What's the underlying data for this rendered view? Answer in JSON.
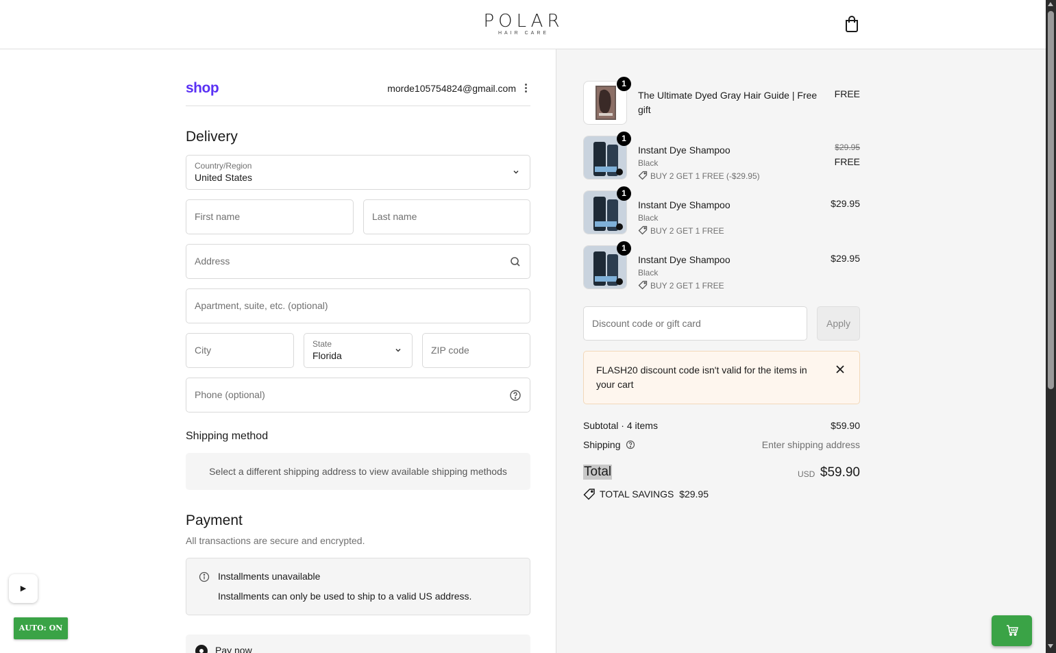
{
  "header": {
    "logo_main": "POLAR",
    "logo_sub": "HAIR CARE"
  },
  "account": {
    "shop_label": "shop",
    "email": "morde105754824@gmail.com"
  },
  "delivery": {
    "heading": "Delivery",
    "country": {
      "label": "Country/Region",
      "value": "United States"
    },
    "first_name": {
      "placeholder": "First name"
    },
    "last_name": {
      "placeholder": "Last name"
    },
    "address": {
      "placeholder": "Address"
    },
    "apartment": {
      "placeholder": "Apartment, suite, etc. (optional)"
    },
    "city": {
      "placeholder": "City"
    },
    "state": {
      "label": "State",
      "value": "Florida"
    },
    "zip": {
      "placeholder": "ZIP code"
    },
    "phone": {
      "placeholder": "Phone (optional)"
    }
  },
  "shipping": {
    "heading": "Shipping method",
    "message": "Select a different shipping address to view available shipping methods"
  },
  "payment": {
    "heading": "Payment",
    "subtitle": "All transactions are secure and encrypted.",
    "installments_title": "Installments unavailable",
    "installments_text": "Installments can only be used to ship to a valid US address.",
    "pay_now_label": "Pay now"
  },
  "controls": {
    "play_symbol": "▶",
    "auto_label": "AUTO: ON"
  },
  "order": {
    "items": [
      {
        "qty": "1",
        "name": "The Ultimate Dyed Gray Hair Guide | Free gift",
        "price": "FREE"
      },
      {
        "qty": "1",
        "name": "Instant Dye Shampoo",
        "variant": "Black",
        "discount": "BUY 2 GET 1 FREE (-$29.95)",
        "old_price": "$29.95",
        "price": "FREE"
      },
      {
        "qty": "1",
        "name": "Instant Dye Shampoo",
        "variant": "Black",
        "discount": "BUY 2 GET 1 FREE",
        "price": "$29.95"
      },
      {
        "qty": "1",
        "name": "Instant Dye Shampoo",
        "variant": "Black",
        "discount": "BUY 2 GET 1 FREE",
        "price": "$29.95"
      }
    ],
    "discount_placeholder": "Discount code or gift card",
    "apply_label": "Apply",
    "alert_text": "FLASH20 discount code isn't valid for the items in your cart",
    "subtotal_label": "Subtotal · 4 items",
    "subtotal_value": "$59.90",
    "shipping_label": "Shipping",
    "shipping_value": "Enter shipping address",
    "total_label": "Total",
    "total_currency": "USD",
    "total_value": "$59.90",
    "savings_label": "TOTAL SAVINGS",
    "savings_value": "$29.95"
  },
  "colors": {
    "shop_brand": "#5a31f4",
    "accent_green": "#3aa346",
    "alert_bg": "#fef6ee"
  }
}
